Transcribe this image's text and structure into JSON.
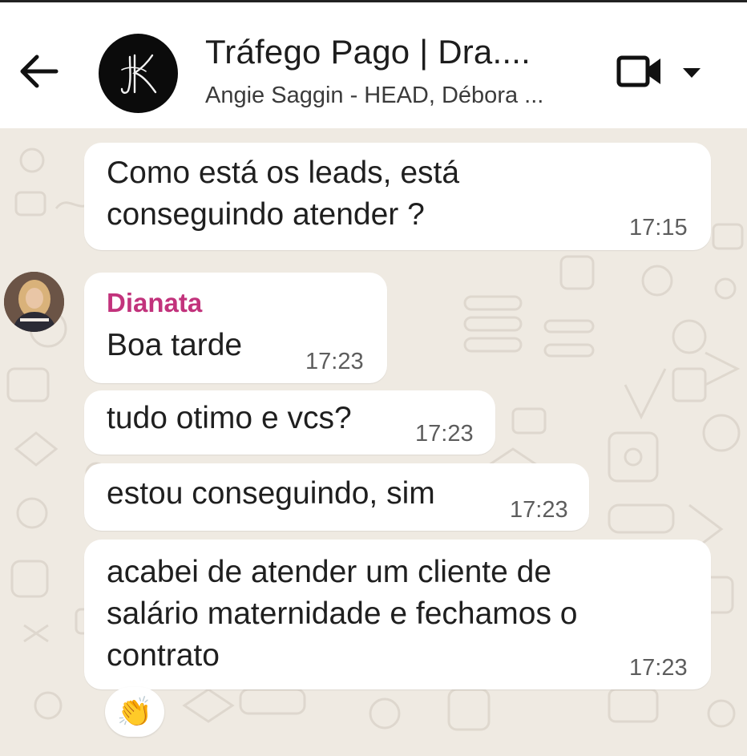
{
  "header": {
    "title": "Tráfego Pago | Dra....",
    "subtitle": "Angie Saggin - HEAD, Débora ...",
    "avatar_monogram": "JK",
    "icons": [
      "arrow-left-icon",
      "video-camera-icon",
      "caret-down-icon"
    ]
  },
  "messages": [
    {
      "text": "Como está os leads, está\nconseguindo atender ?",
      "time": "17:15"
    },
    {
      "sender": "Dianata",
      "text": "Boa tarde",
      "time": "17:23"
    },
    {
      "text": "tudo otimo e vcs?",
      "time": "17:23"
    },
    {
      "text": "estou conseguindo, sim",
      "time": "17:23"
    },
    {
      "text": "acabei de atender um cliente de\nsalário maternidade e fechamos o\ncontrato",
      "time": "17:23"
    }
  ],
  "reaction": {
    "emoji": "👏",
    "name": "clapping-hands"
  },
  "colors": {
    "background": "#efeae2",
    "bubble": "#ffffff",
    "sender_name": "#c2337c",
    "header": "#ffffff"
  }
}
